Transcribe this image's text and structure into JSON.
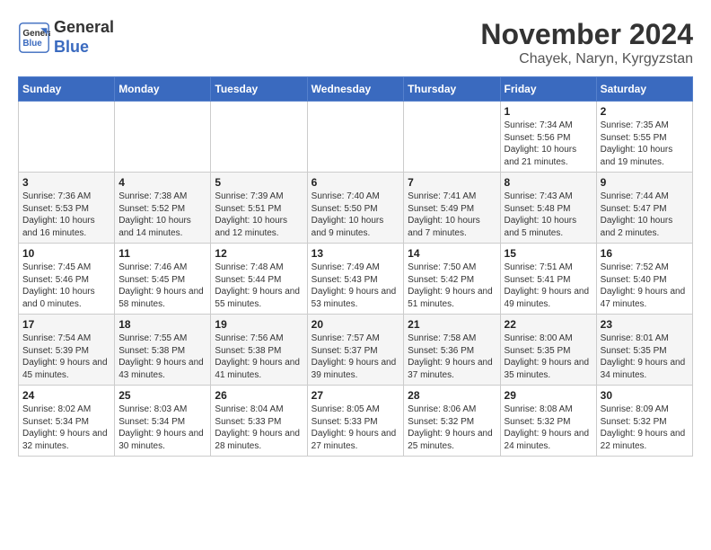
{
  "logo": {
    "line1": "General",
    "line2": "Blue"
  },
  "title": "November 2024",
  "location": "Chayek, Naryn, Kyrgyzstan",
  "weekdays": [
    "Sunday",
    "Monday",
    "Tuesday",
    "Wednesday",
    "Thursday",
    "Friday",
    "Saturday"
  ],
  "weeks": [
    [
      {
        "day": "",
        "info": ""
      },
      {
        "day": "",
        "info": ""
      },
      {
        "day": "",
        "info": ""
      },
      {
        "day": "",
        "info": ""
      },
      {
        "day": "",
        "info": ""
      },
      {
        "day": "1",
        "info": "Sunrise: 7:34 AM\nSunset: 5:56 PM\nDaylight: 10 hours and 21 minutes."
      },
      {
        "day": "2",
        "info": "Sunrise: 7:35 AM\nSunset: 5:55 PM\nDaylight: 10 hours and 19 minutes."
      }
    ],
    [
      {
        "day": "3",
        "info": "Sunrise: 7:36 AM\nSunset: 5:53 PM\nDaylight: 10 hours and 16 minutes."
      },
      {
        "day": "4",
        "info": "Sunrise: 7:38 AM\nSunset: 5:52 PM\nDaylight: 10 hours and 14 minutes."
      },
      {
        "day": "5",
        "info": "Sunrise: 7:39 AM\nSunset: 5:51 PM\nDaylight: 10 hours and 12 minutes."
      },
      {
        "day": "6",
        "info": "Sunrise: 7:40 AM\nSunset: 5:50 PM\nDaylight: 10 hours and 9 minutes."
      },
      {
        "day": "7",
        "info": "Sunrise: 7:41 AM\nSunset: 5:49 PM\nDaylight: 10 hours and 7 minutes."
      },
      {
        "day": "8",
        "info": "Sunrise: 7:43 AM\nSunset: 5:48 PM\nDaylight: 10 hours and 5 minutes."
      },
      {
        "day": "9",
        "info": "Sunrise: 7:44 AM\nSunset: 5:47 PM\nDaylight: 10 hours and 2 minutes."
      }
    ],
    [
      {
        "day": "10",
        "info": "Sunrise: 7:45 AM\nSunset: 5:46 PM\nDaylight: 10 hours and 0 minutes."
      },
      {
        "day": "11",
        "info": "Sunrise: 7:46 AM\nSunset: 5:45 PM\nDaylight: 9 hours and 58 minutes."
      },
      {
        "day": "12",
        "info": "Sunrise: 7:48 AM\nSunset: 5:44 PM\nDaylight: 9 hours and 55 minutes."
      },
      {
        "day": "13",
        "info": "Sunrise: 7:49 AM\nSunset: 5:43 PM\nDaylight: 9 hours and 53 minutes."
      },
      {
        "day": "14",
        "info": "Sunrise: 7:50 AM\nSunset: 5:42 PM\nDaylight: 9 hours and 51 minutes."
      },
      {
        "day": "15",
        "info": "Sunrise: 7:51 AM\nSunset: 5:41 PM\nDaylight: 9 hours and 49 minutes."
      },
      {
        "day": "16",
        "info": "Sunrise: 7:52 AM\nSunset: 5:40 PM\nDaylight: 9 hours and 47 minutes."
      }
    ],
    [
      {
        "day": "17",
        "info": "Sunrise: 7:54 AM\nSunset: 5:39 PM\nDaylight: 9 hours and 45 minutes."
      },
      {
        "day": "18",
        "info": "Sunrise: 7:55 AM\nSunset: 5:38 PM\nDaylight: 9 hours and 43 minutes."
      },
      {
        "day": "19",
        "info": "Sunrise: 7:56 AM\nSunset: 5:38 PM\nDaylight: 9 hours and 41 minutes."
      },
      {
        "day": "20",
        "info": "Sunrise: 7:57 AM\nSunset: 5:37 PM\nDaylight: 9 hours and 39 minutes."
      },
      {
        "day": "21",
        "info": "Sunrise: 7:58 AM\nSunset: 5:36 PM\nDaylight: 9 hours and 37 minutes."
      },
      {
        "day": "22",
        "info": "Sunrise: 8:00 AM\nSunset: 5:35 PM\nDaylight: 9 hours and 35 minutes."
      },
      {
        "day": "23",
        "info": "Sunrise: 8:01 AM\nSunset: 5:35 PM\nDaylight: 9 hours and 34 minutes."
      }
    ],
    [
      {
        "day": "24",
        "info": "Sunrise: 8:02 AM\nSunset: 5:34 PM\nDaylight: 9 hours and 32 minutes."
      },
      {
        "day": "25",
        "info": "Sunrise: 8:03 AM\nSunset: 5:34 PM\nDaylight: 9 hours and 30 minutes."
      },
      {
        "day": "26",
        "info": "Sunrise: 8:04 AM\nSunset: 5:33 PM\nDaylight: 9 hours and 28 minutes."
      },
      {
        "day": "27",
        "info": "Sunrise: 8:05 AM\nSunset: 5:33 PM\nDaylight: 9 hours and 27 minutes."
      },
      {
        "day": "28",
        "info": "Sunrise: 8:06 AM\nSunset: 5:32 PM\nDaylight: 9 hours and 25 minutes."
      },
      {
        "day": "29",
        "info": "Sunrise: 8:08 AM\nSunset: 5:32 PM\nDaylight: 9 hours and 24 minutes."
      },
      {
        "day": "30",
        "info": "Sunrise: 8:09 AM\nSunset: 5:32 PM\nDaylight: 9 hours and 22 minutes."
      }
    ]
  ]
}
